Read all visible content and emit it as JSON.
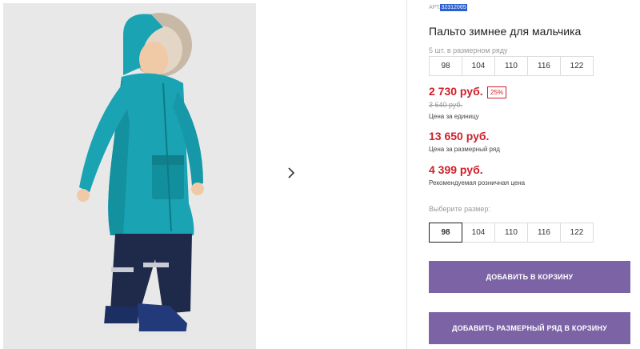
{
  "gallery": {
    "next_icon": "chevron-right-icon"
  },
  "product": {
    "sku_label": "АРТ.",
    "sku_value": "32312065",
    "title": "Пальто зимнее для мальчика",
    "size_row_note": "5 шт. в размерном ряду",
    "size_row_sizes": [
      "98",
      "104",
      "110",
      "116",
      "122"
    ],
    "unit_price": "2 730 руб.",
    "discount": "25%",
    "old_price": "3 640 руб.",
    "unit_price_caption": "Цена за единицу",
    "row_price": "13 650 руб.",
    "row_price_caption": "Цена за размерный ряд",
    "retail_price": "4 399 руб.",
    "retail_price_caption": "Рекомендуемая розничная цена",
    "choose_size_label": "Выберите размер:",
    "sizes": [
      "98",
      "104",
      "110",
      "116",
      "122"
    ],
    "selected_size": "98",
    "add_to_cart": "ДОБАВИТЬ В КОРЗИНУ",
    "add_row_to_cart": "ДОБАВИТЬ РАЗМЕРНЫЙ РЯД В КОРЗИНУ"
  },
  "colors": {
    "price_red": "#d0202a",
    "button_purple": "#7b63a6",
    "coat_teal": "#1aa3b3"
  }
}
